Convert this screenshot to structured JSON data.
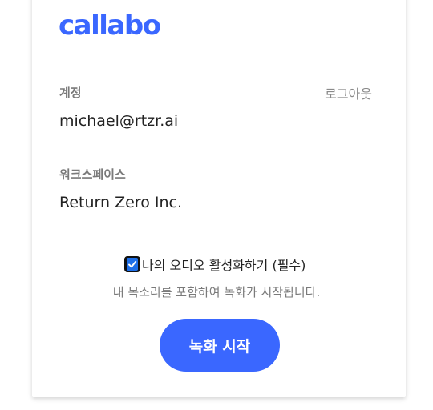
{
  "brand": {
    "logo_text": "callabo",
    "accent_color": "#3a67ff"
  },
  "account": {
    "label": "계정",
    "logout_label": "로그아웃",
    "email": "michael@rtzr.ai"
  },
  "workspace": {
    "label": "워크스페이스",
    "name": "Return Zero Inc."
  },
  "audio": {
    "checkbox_label": "나의 오디오 활성화하기 (필수)",
    "checked": true,
    "hint": "내 목소리를 포함하여 녹화가 시작됩니다."
  },
  "actions": {
    "record_label": "녹화 시작"
  }
}
